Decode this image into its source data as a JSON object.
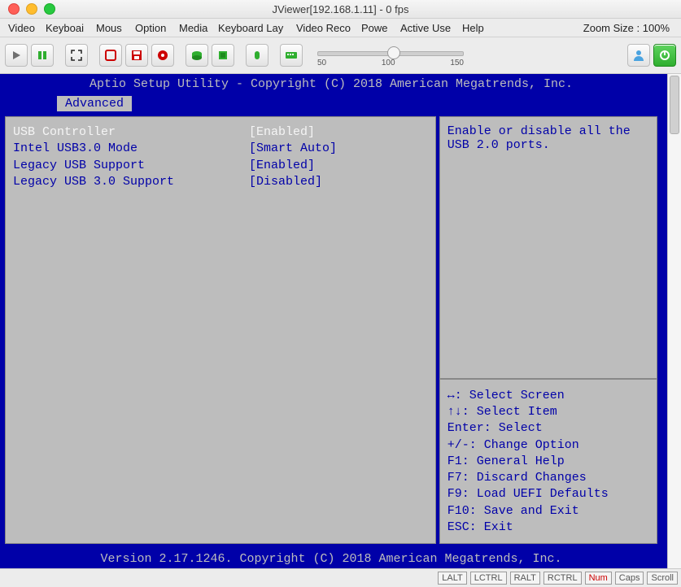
{
  "window": {
    "title": "JViewer[192.168.1.11] - 0 fps"
  },
  "menu": {
    "items": [
      "Video",
      "Keyboai",
      "Mous",
      "Option",
      "Media",
      "Keyboard Lay",
      "Video Reco",
      "Powe",
      "Active Use",
      "Help"
    ],
    "zoom_label": "Zoom Size : 100%"
  },
  "toolbar": {
    "icons": {
      "play": "play-icon",
      "pause": "pause-icon",
      "fullscreen": "fullscreen-icon",
      "record": "record-icon",
      "save": "save-icon",
      "disc": "disc-icon",
      "hdd": "hdd-icon",
      "chip": "chip-icon",
      "mouse": "mouse-icon",
      "keyboard": "keyboard-icon",
      "hotkey": "hotkey-icon",
      "user": "user-icon",
      "power": "power-icon"
    },
    "slider": {
      "ticks": [
        "50",
        "100",
        "150"
      ],
      "value": 100
    }
  },
  "bios": {
    "header": "Aptio Setup Utility - Copyright (C) 2018 American Megatrends, Inc.",
    "tab": "Advanced",
    "rows": [
      {
        "label": "USB Controller",
        "value": "[Enabled]",
        "selected": true
      },
      {
        "label": "Intel USB3.0 Mode",
        "value": "[Smart Auto]",
        "selected": false
      },
      {
        "label": "Legacy USB Support",
        "value": "[Enabled]",
        "selected": false
      },
      {
        "label": "Legacy USB 3.0 Support",
        "value": "[Disabled]",
        "selected": false
      }
    ],
    "help_text": "Enable or disable all the USB 2.0 ports.",
    "keys": [
      "↔: Select Screen",
      "↑↓: Select Item",
      "Enter: Select",
      "+/-: Change Option",
      "F1: General Help",
      "F7: Discard Changes",
      "F9: Load UEFI Defaults",
      "F10: Save and Exit",
      "ESC: Exit"
    ],
    "footer": "Version 2.17.1246. Copyright (C) 2018 American Megatrends, Inc."
  },
  "status": {
    "keys": [
      {
        "label": "LALT",
        "on": false
      },
      {
        "label": "LCTRL",
        "on": false
      },
      {
        "label": "RALT",
        "on": false
      },
      {
        "label": "RCTRL",
        "on": false
      },
      {
        "label": "Num",
        "on": true
      },
      {
        "label": "Caps",
        "on": false
      },
      {
        "label": "Scroll",
        "on": false
      }
    ]
  }
}
